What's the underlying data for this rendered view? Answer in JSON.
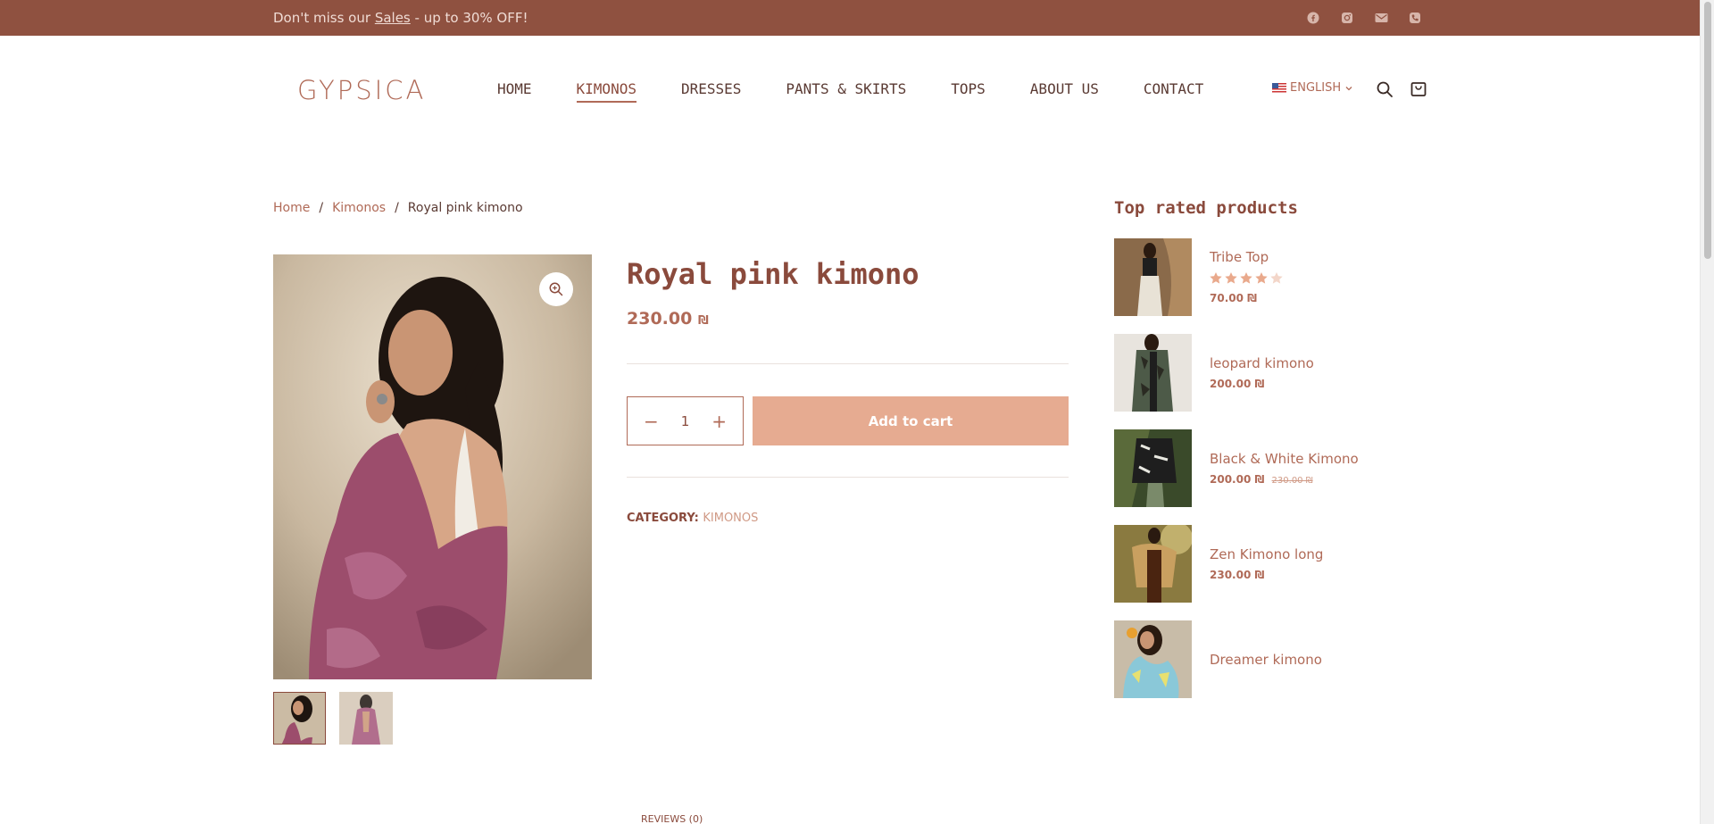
{
  "topbar": {
    "promo_before": "Don't miss our ",
    "promo_link": "Sales",
    "promo_after": " - up to 30% OFF!",
    "social_icons": [
      "facebook-icon",
      "instagram-icon",
      "mail-icon",
      "phone-icon"
    ]
  },
  "header": {
    "logo": "GYPSICA",
    "nav": [
      "HOME",
      "KIMONOS",
      "DRESSES",
      "PANTS & SKIRTS",
      "TOPS",
      "ABOUT US",
      "CONTACT"
    ],
    "active_nav": "KIMONOS",
    "language": "ENGLISH"
  },
  "breadcrumb": {
    "home": "Home",
    "category": "Kimonos",
    "current": "Royal pink kimono",
    "separator": "/"
  },
  "product": {
    "title": "Royal pink kimono",
    "price": "230.00",
    "currency": "₪",
    "quantity": "1",
    "add_to_cart": "Add to cart",
    "category_label": "CATEGORY:",
    "category_value": "KIMONOS"
  },
  "sidebar": {
    "title": "Top rated products",
    "products": [
      {
        "name": "Tribe Top",
        "price": "70.00",
        "currency": "₪",
        "rating": 4
      },
      {
        "name": "leopard kimono",
        "price": "200.00",
        "currency": "₪"
      },
      {
        "name": "Black & White Kimono",
        "price": "200.00",
        "currency": "₪",
        "old_price": "230.00 ₪"
      },
      {
        "name": "Zen Kimono long",
        "price": "230.00",
        "currency": "₪"
      },
      {
        "name": "Dreamer kimono"
      }
    ]
  },
  "tabs": {
    "reviews": "REVIEWS (0)"
  },
  "colors": {
    "topbar": "#8f5140",
    "accent": "#b06a57",
    "button": "#e6ab91",
    "text": "#8a4a3c"
  }
}
